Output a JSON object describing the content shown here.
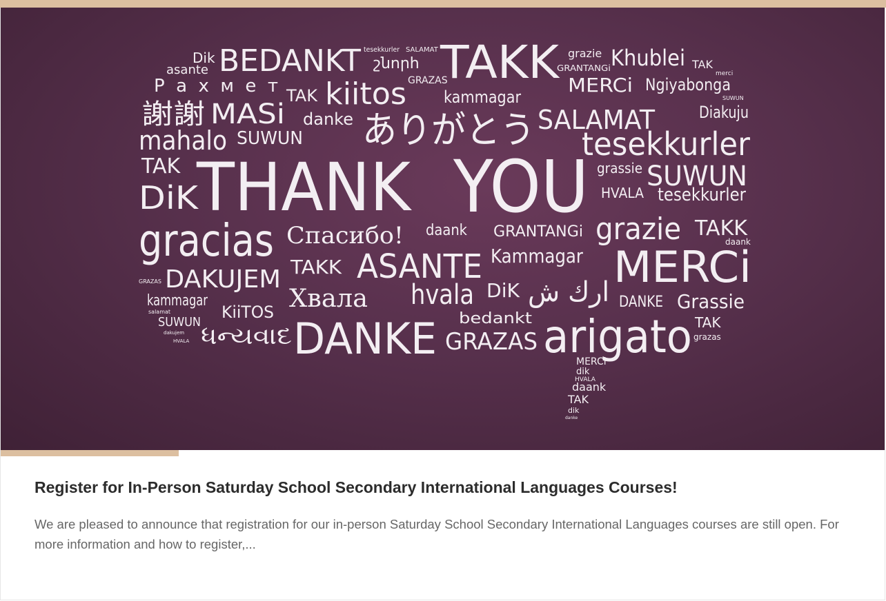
{
  "post": {
    "title": "Register for In-Person Saturday School Secondary International Languages Courses!",
    "excerpt": "We are pleased to announce that registration for our in-person Saturday School Secondary International Languages courses are still open. For more information and how to register,..."
  },
  "image": {
    "words": {
      "w1": "Dik",
      "w2": "BEDANKT",
      "w3": "tesekkurler",
      "w4": "SALAMAT",
      "w5": "շնորհ",
      "w6": "TAKK",
      "w7": "grazie",
      "w8": "GRANTANGi",
      "w9": "Khublei",
      "w10": "TAK",
      "w11": "merci",
      "w12": "asante",
      "w13": "Рахмет",
      "w14": "TAK",
      "w15": "kiitos",
      "w16": "GRAZAS",
      "w17": "kammagar",
      "w18": "MERCi",
      "w19": "Ngiyabonga",
      "w20": "SUWUN",
      "w21": "謝謝",
      "w22": "MASi",
      "w23": "danke",
      "w24": "ありがとう",
      "w25": "SALAMAT",
      "w26": "Diakuju",
      "w27": "mahalo",
      "w28": "SUWUN",
      "w29": "tesekkurler",
      "w30": "TAK",
      "w31": "DiK",
      "w32": "THANK",
      "w33": "YOU",
      "w34": "grassie",
      "w35": "SUWUN",
      "w36": "HVALA",
      "w37": "tesekkurler",
      "w38": "gracias",
      "w39": "Спасибо!",
      "w40": "daank",
      "w41": "GRANTANGi",
      "w42": "grazie",
      "w43": "TAKK",
      "w44": "daank",
      "w45": "GRAZAS",
      "w46": "DAKUJEM",
      "w47": "TAKK",
      "w48": "ASANTE",
      "w49": "Kammagar",
      "w50": "MERCi",
      "w51": "kammagar",
      "w52": "Хвала",
      "w53": "hvala",
      "w54": "DiK",
      "w55": "ارك ش",
      "w56": "DANKE",
      "w57": "Grassie",
      "w58": "salamat",
      "w59": "KiiTOS",
      "w60": "SUWUN",
      "w61": "dakujem",
      "w62": "HVALA",
      "w63": "ધન્યવાદ",
      "w64": "DANKE",
      "w65": "bedankt",
      "w66": "GRAZAS",
      "w67": "arigato",
      "w68": "TAK",
      "w69": "grazas",
      "w70": "MERCi",
      "w71": "dik",
      "w72": "HVALA",
      "w73": "daank",
      "w74": "TAK",
      "w75": "dik",
      "w76": "danke"
    }
  },
  "colors": {
    "accent": "#dcbfa0",
    "chalkboard": "#57304c",
    "chalk": "#f3eef2",
    "title": "#2c2c2c",
    "excerpt": "#666666"
  }
}
